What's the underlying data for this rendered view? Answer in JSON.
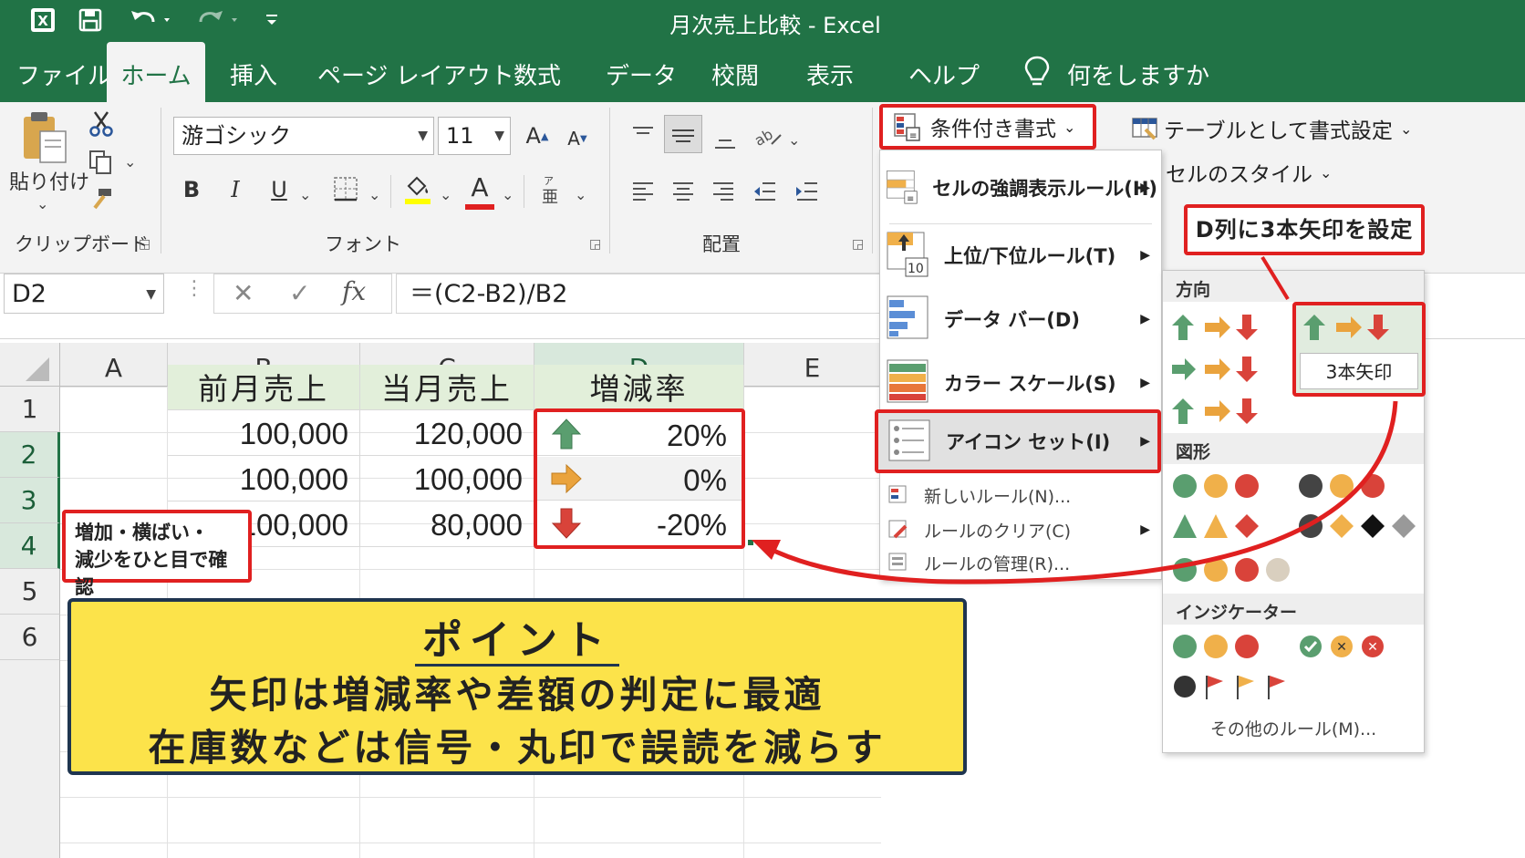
{
  "window": {
    "title": "月次売上比較  -  Excel"
  },
  "tabs": [
    {
      "label": "ファイル"
    },
    {
      "label": "ホーム"
    },
    {
      "label": "挿入"
    },
    {
      "label": "ページ レイアウト"
    },
    {
      "label": "数式"
    },
    {
      "label": "データ"
    },
    {
      "label": "校閲"
    },
    {
      "label": "表示"
    },
    {
      "label": "ヘルプ"
    }
  ],
  "tellme": {
    "placeholder": "何をしますか"
  },
  "clipboard": {
    "paste_label": "貼り付け",
    "group_label": "クリップボード"
  },
  "font": {
    "name": "游ゴシック",
    "size": "11",
    "bold": "B",
    "italic": "I",
    "underline": "U",
    "color_letter": "A",
    "group_label": "フォント"
  },
  "alignment": {
    "group_label": "配置"
  },
  "styles": {
    "conditional_formatting": "条件付き書式",
    "format_as_table": "テーブルとして書式設定",
    "cell_styles": "セルのスタイル"
  },
  "formula": {
    "name_box": "D2",
    "fx": "fx",
    "content": "＝(C2-B2)/B2"
  },
  "sheet": {
    "columns": [
      "A",
      "B",
      "C",
      "D",
      "E"
    ],
    "rows": [
      "1",
      "2",
      "3",
      "4",
      "5",
      "6"
    ],
    "header_row": [
      "前月売上",
      "当月売上",
      "増減率"
    ],
    "data": [
      {
        "prev": "100,000",
        "curr": "120,000",
        "rate": "20%",
        "icon": "arrow-up"
      },
      {
        "prev": "100,000",
        "curr": "100,000",
        "rate": "0%",
        "icon": "arrow-right"
      },
      {
        "prev": "100,000",
        "curr": "80,000",
        "rate": "-20%",
        "icon": "arrow-down"
      }
    ]
  },
  "cf_menu": {
    "items": [
      {
        "label": "セルの強調表示ルール(H)",
        "icon": "highlight-rules-icon"
      },
      {
        "label": "上位/下位ルール(T)",
        "icon": "top-bottom-icon"
      },
      {
        "label": "データ バー(D)",
        "icon": "data-bar-icon"
      },
      {
        "label": "カラー スケール(S)",
        "icon": "color-scale-icon"
      },
      {
        "label": "アイコン セット(I)",
        "icon": "icon-set-icon"
      }
    ],
    "small_items": [
      {
        "label": "新しいルール(N)..."
      },
      {
        "label": "ルールのクリア(C)"
      },
      {
        "label": "ルールの管理(R)..."
      }
    ]
  },
  "icon_sets": {
    "sections": {
      "direction": "方向",
      "shapes": "図形",
      "indicators": "インジケーター"
    },
    "selected_label": "3本矢印",
    "more_rules": "その他のルール(M)..."
  },
  "colors": {
    "green": "#5a9e6f",
    "yellow": "#f0b04a",
    "red": "#d9433a",
    "orange": "#eaa33d",
    "excel_green": "#217346",
    "callout_red": "#e02020",
    "point_yellow": "#fce34a"
  },
  "callouts": {
    "d_column": "D列に3本矢印を設定",
    "glance_line1": "増加・横ばい・",
    "glance_line2": "減少をひと目で確認"
  },
  "point": {
    "title": "ポイント",
    "line1": "矢印は増減率や差額の判定に最適",
    "line2": "在庫数などは信号・丸印で誤読を減らす"
  }
}
